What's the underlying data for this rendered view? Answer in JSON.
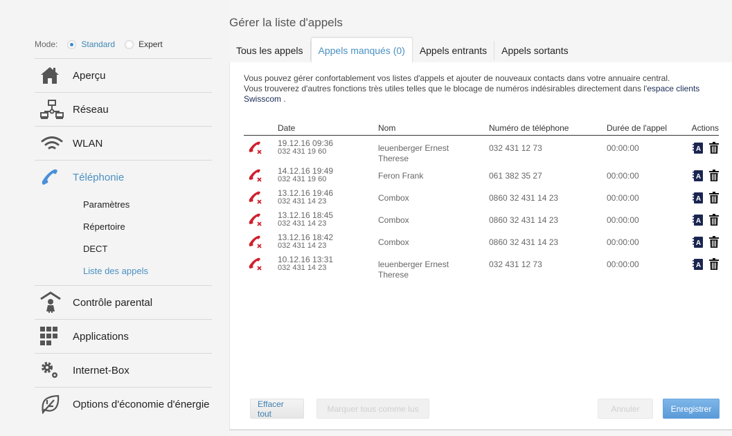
{
  "sidebar": {
    "mode": {
      "label": "Mode:",
      "options": [
        {
          "label": "Standard",
          "selected": true
        },
        {
          "label": "Expert",
          "selected": false
        }
      ]
    },
    "items": [
      {
        "label": "Aperçu",
        "icon": "home-icon"
      },
      {
        "label": "Réseau",
        "icon": "network-icon"
      },
      {
        "label": "WLAN",
        "icon": "wifi-icon"
      },
      {
        "label": "Téléphonie",
        "icon": "phone-icon",
        "active": true,
        "subitems": [
          {
            "label": "Paramètres"
          },
          {
            "label": "Répertoire"
          },
          {
            "label": "DECT"
          },
          {
            "label": "Liste des appels",
            "active": true
          }
        ]
      },
      {
        "label": "Contrôle parental",
        "icon": "parental-control-icon"
      },
      {
        "label": "Applications",
        "icon": "apps-grid-icon"
      },
      {
        "label": "Internet-Box",
        "icon": "gears-icon"
      },
      {
        "label": "Options d'économie d'énergie",
        "icon": "leaf-icon"
      }
    ]
  },
  "main": {
    "title": "Gérer la liste d'appels",
    "tabs": [
      {
        "label": "Tous les appels"
      },
      {
        "label": "Appels manqués (0)",
        "active": true
      },
      {
        "label": "Appels entrants"
      },
      {
        "label": "Appels sortants"
      }
    ],
    "intro": {
      "line1": "Vous pouvez gérer confortablement vos listes d'appels et ajouter de nouveaux contacts dans votre annuaire central.",
      "line2": "Vous trouverez d'autres fonctions très utiles telles que le blocage de numéros indésirables directement dans l'",
      "link": "espace clients Swisscom",
      "tail": " ."
    },
    "table": {
      "headers": {
        "date": "Date",
        "nom": "Nom",
        "numero": "Numéro de téléphone",
        "duree": "Durée de l'appel",
        "actions": "Actions"
      },
      "rows": [
        {
          "date": "19.12.16 09:36",
          "line": "032 431 19 60",
          "nom": "leuenberger Ernest Therese",
          "numero": "032 431 12 73",
          "duree": "00:00:00"
        },
        {
          "date": "14.12.16 19:49",
          "line": "032 431 19 60",
          "nom": "Feron Frank",
          "numero": "061 382 35 27",
          "duree": "00:00:00"
        },
        {
          "date": "13.12.16 19:46",
          "line": "032 431 14 23",
          "nom": "Combox",
          "numero": "0860 32 431 14 23",
          "duree": "00:00:00"
        },
        {
          "date": "13.12.16 18:45",
          "line": "032 431 14 23",
          "nom": "Combox",
          "numero": "0860 32 431 14 23",
          "duree": "00:00:00"
        },
        {
          "date": "13.12.16 18:42",
          "line": "032 431 14 23",
          "nom": "Combox",
          "numero": "0860 32 431 14 23",
          "duree": "00:00:00"
        },
        {
          "date": "10.12.16 13:31",
          "line": "032 431 14 23",
          "nom": "leuenberger Ernest Therese",
          "numero": "032 431 12 73",
          "duree": "00:00:00"
        }
      ]
    },
    "buttons": {
      "clear_all": "Effacer tout",
      "mark_all_read": "Marquer tous comme lus",
      "cancel": "Annuler",
      "save": "Enregistrer"
    }
  },
  "colors": {
    "accent": "#4a90c2",
    "missed_call": "#d0202e",
    "action_icon": "#1a2550"
  }
}
